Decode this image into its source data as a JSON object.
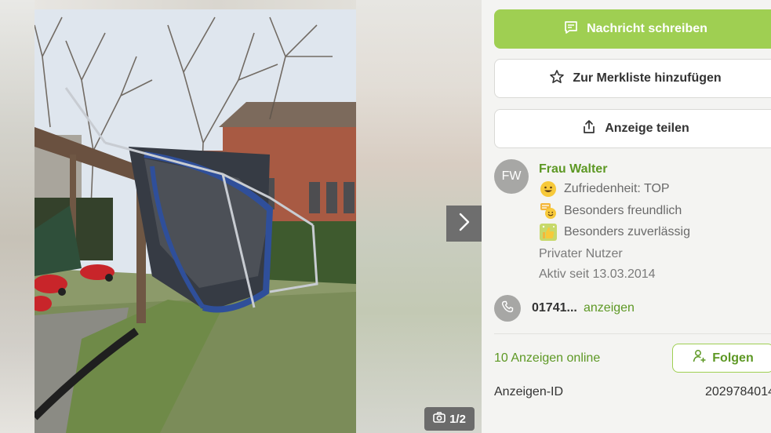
{
  "gallery": {
    "counter": "1/2",
    "icons": {
      "next": "chevron-right-icon",
      "counter": "camera-icon"
    }
  },
  "actions": {
    "message_label": "Nachricht schreiben",
    "watchlist_label": "Zur Merkliste hinzufügen",
    "share_label": "Anzeige teilen",
    "icons": {
      "message": "chat-icon",
      "watchlist": "star-outline-icon",
      "share": "share-icon"
    }
  },
  "seller": {
    "initials": "FW",
    "name": "Frau Walter",
    "badges": [
      {
        "label": "Zufriedenheit: TOP",
        "icon": "smiley-icon"
      },
      {
        "label": "Besonders freundlich",
        "icon": "chat-smiley-icon"
      },
      {
        "label": "Besonders zuverlässig",
        "icon": "thumbs-up-icon"
      }
    ],
    "type": "Privater Nutzer",
    "active_since": "Aktiv seit 13.03.2014",
    "phone": "01741...",
    "phone_link": "anzeigen",
    "ads_online": "10 Anzeigen online",
    "follow_label": "Folgen"
  },
  "ad": {
    "id_label": "Anzeigen-ID",
    "id_value": "2029784014"
  },
  "colors": {
    "accent": "#9fcf52",
    "accent_text": "#5d9824",
    "background": "#f4f4f2"
  }
}
